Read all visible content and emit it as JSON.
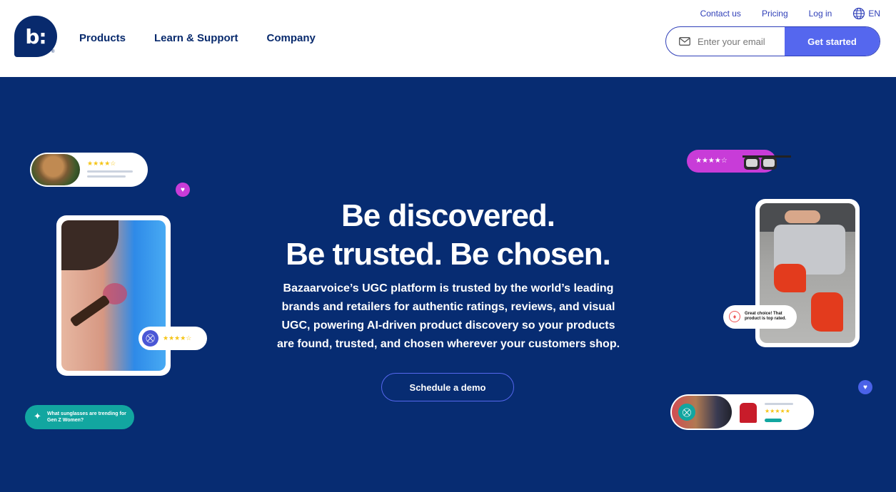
{
  "header": {
    "logo_text": "b:",
    "logo_mark": "®",
    "nav": [
      "Products",
      "Learn & Support",
      "Company"
    ],
    "util_links": [
      "Contact us",
      "Pricing",
      "Log in"
    ],
    "language": "EN",
    "email_placeholder": "Enter your email",
    "cta": "Get started"
  },
  "hero": {
    "headline_1": "Be discovered.",
    "headline_2": "Be trusted. Be chosen.",
    "subtext": "Bazaarvoice’s UGC platform is trusted by the world’s leading brands and retailers for authentic ratings, reviews, and visual UGC, powering AI-driven product discovery so your products are found, trusted, and chosen wherever your customers shop.",
    "demo_button": "Schedule a demo",
    "ai_prompt": "What sunglasses are trending for Gen Z Women?",
    "badge_text": "Great choice! That product is top rated.",
    "stars_4_5": "★★★★☆",
    "stars_5": "★★★★★"
  },
  "colors": {
    "navy": "#072c72",
    "accent": "#5567ee",
    "magenta": "#c83cd8",
    "teal": "#12a6a0"
  }
}
